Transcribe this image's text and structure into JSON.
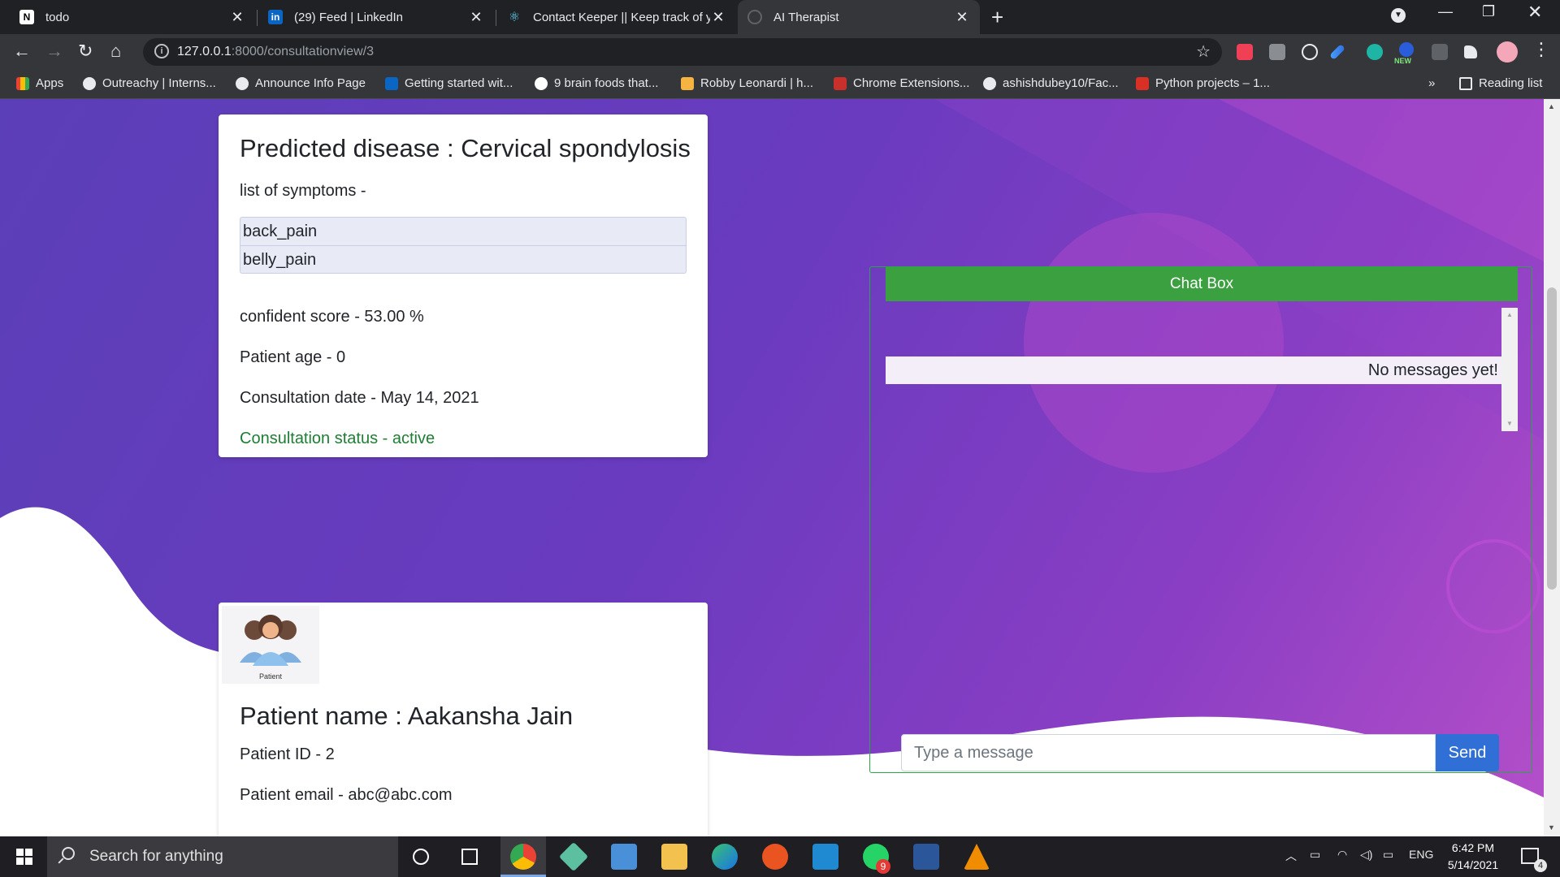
{
  "browser": {
    "tabs": [
      {
        "title": "todo",
        "favicon": "notion-icon"
      },
      {
        "title": "(29) Feed | LinkedIn",
        "favicon": "linkedin-icon"
      },
      {
        "title": "Contact Keeper || Keep track of yo",
        "favicon": "react-icon"
      },
      {
        "title": "AI Therapist",
        "favicon": "globe-icon",
        "active": true
      }
    ],
    "url_host": "127.0.0.1",
    "url_rest": ":8000/consultationview/3",
    "bookmarks": [
      "Apps",
      "Outreachy | Interns...",
      "Announce Info Page",
      "Getting started wit...",
      "9 brain foods that...",
      "Robby Leonardi | h...",
      "Chrome Extensions...",
      "ashishdubey10/Fac...",
      "Python projects – 1..."
    ],
    "reading_list": "Reading list",
    "more_bookmarks": "»",
    "new_badge": "NEW"
  },
  "prediction": {
    "title": "Predicted disease : Cervical spondylosis",
    "symptoms_label": "list of symptoms -",
    "symptoms": [
      "back_pain",
      "belly_pain"
    ],
    "confidence": "confident score - 53.00 %",
    "age": "Patient age - 0",
    "date": "Consultation date - May 14, 2021",
    "status": "Consultation status - active",
    "status_color": "#1e7e34"
  },
  "patient": {
    "avatar_caption": "Patient",
    "name": "Patient name : Aakansha Jain",
    "id": "Patient ID - 2",
    "email": "Patient email - abc@abc.com"
  },
  "chat": {
    "header": "Chat Box",
    "empty_text": "No messages yet!",
    "placeholder": "Type a message",
    "send_label": "Send",
    "header_color": "#3aa040",
    "send_color": "#2f6fd6"
  },
  "taskbar": {
    "search_placeholder": "Search for anything",
    "language": "ENG",
    "time": "6:42 PM",
    "date": "5/14/2021",
    "whatsapp_badge": "9",
    "notification_count": "4"
  }
}
